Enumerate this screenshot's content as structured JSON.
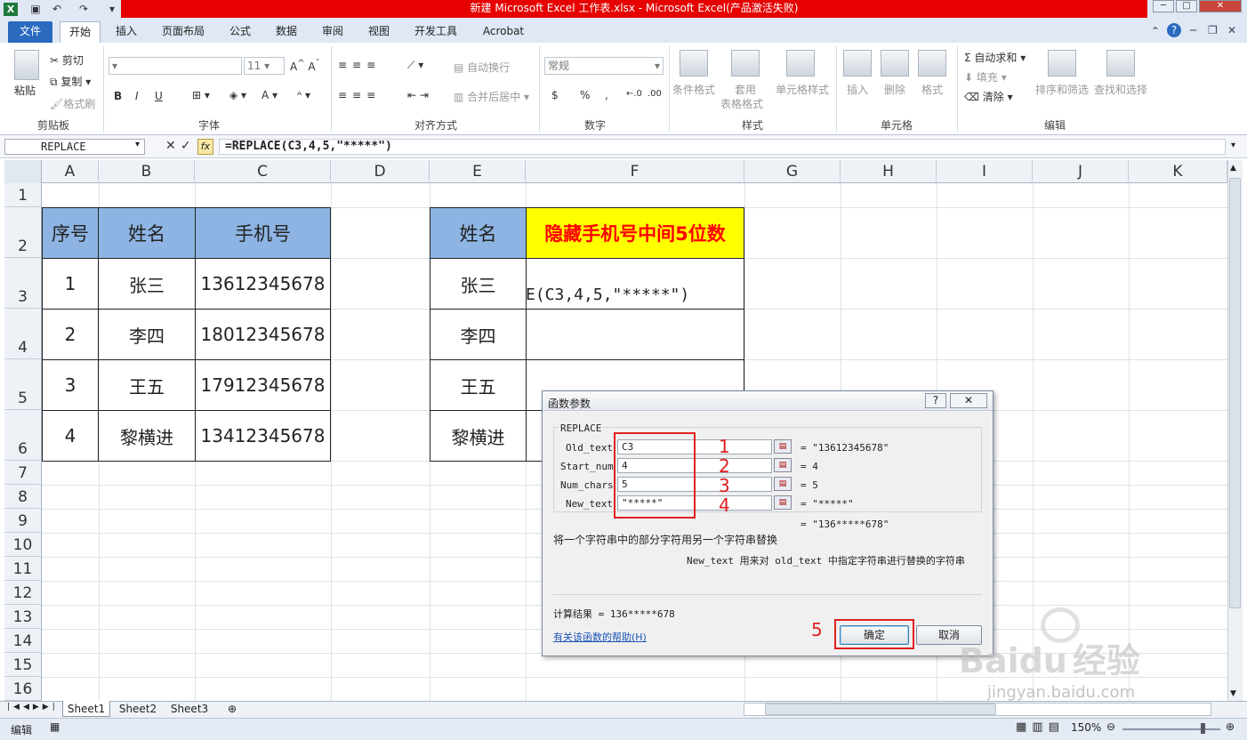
{
  "window": {
    "title": "新建 Microsoft Excel 工作表.xlsx  -  Microsoft Excel(产品激活失败)"
  },
  "ribbon_tabs": [
    "文件",
    "开始",
    "插入",
    "页面布局",
    "公式",
    "数据",
    "审阅",
    "视图",
    "开发工具",
    "Acrobat"
  ],
  "ribbon": {
    "clipboard": {
      "label": "剪贴板",
      "paste": "粘贴",
      "cut": "剪切",
      "copy": "复制",
      "format_painter": "格式刷"
    },
    "font": {
      "label": "字体",
      "size": "11",
      "bold": "B",
      "italic": "I",
      "underline": "U"
    },
    "alignment": {
      "label": "对齐方式",
      "wrap": "自动换行",
      "merge": "合并后居中"
    },
    "number": {
      "label": "数字",
      "format": "常规",
      "currency": "$",
      "percent": "%",
      "comma": ",",
      "inc": "←.0",
      "dec": ".00"
    },
    "styles": {
      "label": "样式",
      "cond": "条件格式",
      "table_a": "套用",
      "table_b": "表格格式",
      "cell": "单元格样式"
    },
    "cells": {
      "label": "单元格",
      "insert": "插入",
      "delete": "删除",
      "format": "格式"
    },
    "editing": {
      "label": "编辑",
      "autosum": "自动求和",
      "fill": "填充",
      "clear": "清除",
      "sort": "排序和筛选",
      "find": "查找和选择"
    }
  },
  "formula_bar": {
    "name_box": "REPLACE",
    "formula": "=REPLACE(C3,4,5,\"*****\")"
  },
  "columns": [
    "A",
    "B",
    "C",
    "D",
    "E",
    "F",
    "G",
    "H",
    "I",
    "J",
    "K"
  ],
  "rows": [
    "1",
    "2",
    "3",
    "4",
    "5",
    "6",
    "7",
    "8",
    "9",
    "10",
    "11",
    "12",
    "13",
    "14",
    "15",
    "16"
  ],
  "table1": {
    "headers": [
      "序号",
      "姓名",
      "手机号"
    ],
    "rows": [
      [
        "1",
        "张三",
        "13612345678"
      ],
      [
        "2",
        "李四",
        "18012345678"
      ],
      [
        "3",
        "王五",
        "17912345678"
      ],
      [
        "4",
        "黎横进",
        "13412345678"
      ]
    ]
  },
  "table2": {
    "headers": [
      "姓名",
      "隐藏手机号中间5位数"
    ],
    "names": [
      "张三",
      "李四",
      "王五",
      "黎横进"
    ],
    "editing_text": "E(C3,4,5,\"*****\")"
  },
  "dialog": {
    "title": "函数参数",
    "help_btn": "?",
    "close_btn": "✕",
    "func_name": "REPLACE",
    "args": [
      {
        "label": "Old_text",
        "value": "C3",
        "result": "= \"13612345678\"",
        "mark": "1"
      },
      {
        "label": "Start_num",
        "value": "4",
        "result": "= 4",
        "mark": "2"
      },
      {
        "label": "Num_chars",
        "value": "5",
        "result": "= 5",
        "mark": "3"
      },
      {
        "label": "New_text",
        "value": "\"*****\"",
        "result": "= \"*****\"",
        "mark": "4"
      }
    ],
    "total_result": "= \"136*****678\"",
    "description": "将一个字符串中的部分字符用另一个字符串替换",
    "arg_help": "New_text  用来对 old_text 中指定字符串进行替换的字符串",
    "calc_result": "计算结果 =  136*****678",
    "help_link": "有关该函数的帮助(H)",
    "ok_mark": "5",
    "ok": "确定",
    "cancel": "取消"
  },
  "sheets": [
    "Sheet1",
    "Sheet2",
    "Sheet3"
  ],
  "status": {
    "mode": "编辑",
    "zoom": "150%"
  },
  "watermark": {
    "brand": "Bai",
    "brand2": "du",
    "cn": "经验",
    "url": "jingyan.baidu.com"
  },
  "colors": {
    "header_fill": "#8db4e2",
    "highlight_fill": "#ffff00",
    "highlight_text": "#ff0000",
    "annotation": "#e02020"
  }
}
